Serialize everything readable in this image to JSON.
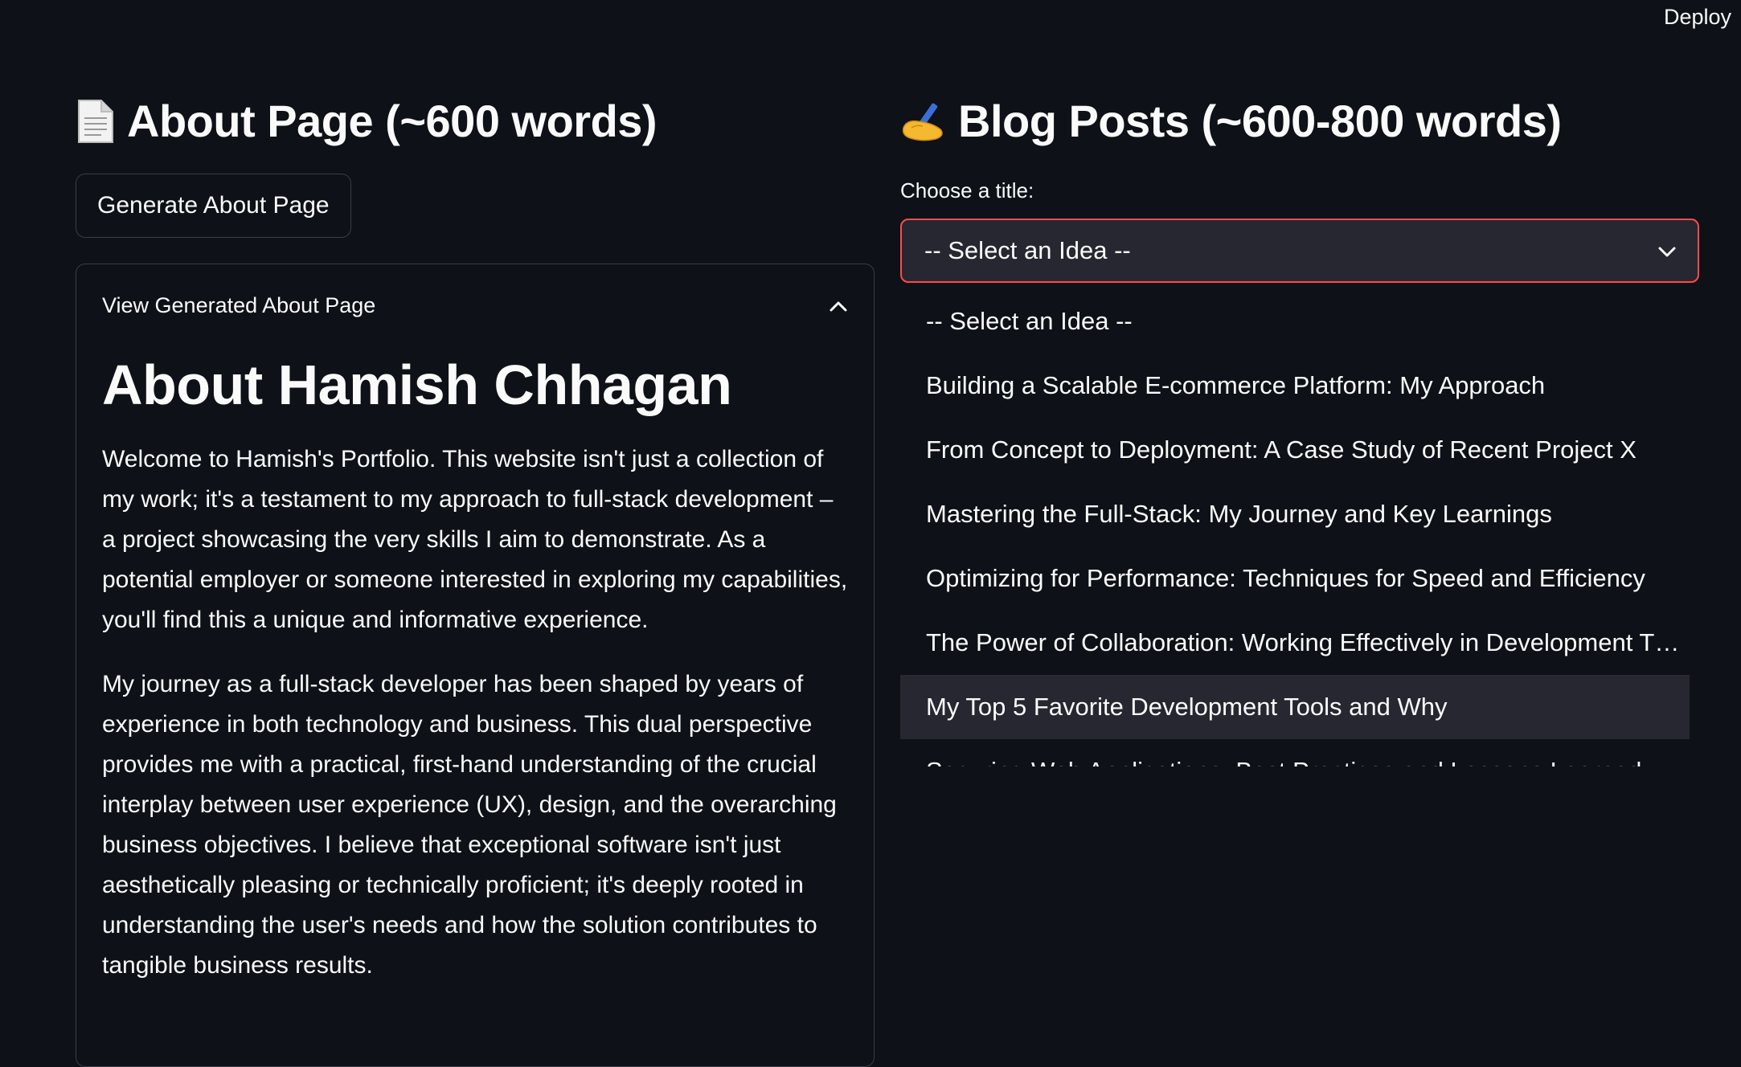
{
  "header": {
    "deploy_label": "Deploy"
  },
  "about": {
    "heading_text": "About Page (~600 words)",
    "heading_icon": "page-icon",
    "generate_button": "Generate About Page",
    "expander_label": "View Generated About Page",
    "title": "About Hamish Chhagan",
    "paragraphs": [
      "Welcome to Hamish's Portfolio. This website isn't just a collection of my work; it's a testament to my approach to full-stack development – a project showcasing the very skills I aim to demonstrate. As a potential employer or someone interested in exploring my capabilities, you'll find this a unique and informative experience.",
      "My journey as a full-stack developer has been shaped by years of experience in both technology and business. This dual perspective provides me with a practical, first-hand understanding of the crucial interplay between user experience (UX), design, and the overarching business objectives. I believe that exceptional software isn't just aesthetically pleasing or technically proficient; it's deeply rooted in understanding the user's needs and how the solution contributes to tangible business results."
    ]
  },
  "blog": {
    "heading_text": "Blog Posts (~600-800 words)",
    "heading_icon": "writing-hand-icon",
    "choose_label": "Choose a title:",
    "selected_value": "-- Select an Idea --",
    "options": [
      "-- Select an Idea --",
      "Building a Scalable E-commerce Platform: My Approach",
      "From Concept to Deployment: A Case Study of Recent Project X",
      "Mastering the Full-Stack: My Journey and Key Learnings",
      "Optimizing for Performance: Techniques for Speed and Efficiency",
      "The Power of Collaboration: Working Effectively in Development T…",
      "My Top 5 Favorite Development Tools and Why",
      "Securing Web Applications: Best Practices and Lessons Learned"
    ]
  },
  "colors": {
    "background": "#0e1117",
    "select_border": "#ff4b4b",
    "highlight": "#262730"
  }
}
